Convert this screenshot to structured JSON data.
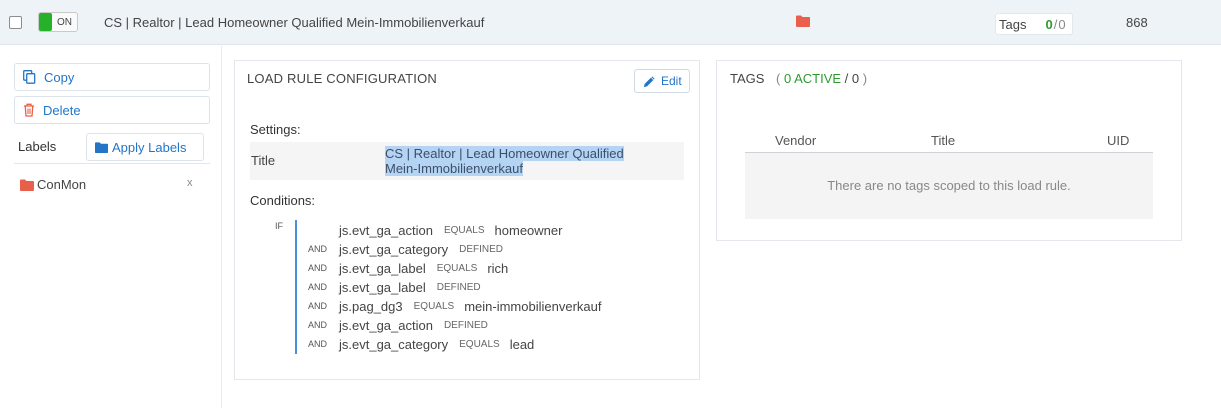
{
  "row": {
    "toggle_label": "ON",
    "rule_name": "CS | Realtor | Lead Homeowner Qualified Mein-Immobilienverkauf",
    "tags_label": "Tags",
    "tags_active": "0",
    "tags_sep": "/",
    "tags_total": "0",
    "rule_id": "868"
  },
  "sidebar": {
    "copy_label": "Copy",
    "delete_label": "Delete",
    "labels_heading": "Labels",
    "apply_labels_label": "Apply Labels",
    "label_items": [
      {
        "name": "ConMon",
        "remove": "x"
      }
    ]
  },
  "config": {
    "heading": "LOAD RULE CONFIGURATION",
    "edit_label": "Edit",
    "settings_heading": "Settings:",
    "title_label": "Title",
    "title_value": "CS | Realtor | Lead Homeowner Qualified Mein-Immobilienverkauf",
    "conditions_heading": "Conditions:",
    "if_label": "IF",
    "conditions": [
      {
        "join": "",
        "variable": "js.evt_ga_action",
        "operator": "EQUALS",
        "value": "homeowner"
      },
      {
        "join": "AND",
        "variable": "js.evt_ga_category",
        "operator": "DEFINED",
        "value": ""
      },
      {
        "join": "AND",
        "variable": "js.evt_ga_label",
        "operator": "EQUALS",
        "value": "rich"
      },
      {
        "join": "AND",
        "variable": "js.evt_ga_label",
        "operator": "DEFINED",
        "value": ""
      },
      {
        "join": "AND",
        "variable": "js.pag_dg3",
        "operator": "EQUALS",
        "value": "mein-immobilienverkauf"
      },
      {
        "join": "AND",
        "variable": "js.evt_ga_action",
        "operator": "DEFINED",
        "value": ""
      },
      {
        "join": "AND",
        "variable": "js.evt_ga_category",
        "operator": "EQUALS",
        "value": "lead"
      }
    ]
  },
  "tags_panel": {
    "heading": "TAGS",
    "count_open": "(",
    "count_active": "0 ACTIVE",
    "count_sep": "/",
    "count_total": "0",
    "count_close": ")",
    "columns": [
      "Vendor",
      "Title",
      "UID"
    ],
    "empty_message": "There are no tags scoped to this load rule."
  },
  "colors": {
    "accent": "#2375c8",
    "on_green": "#25b12a",
    "active_green": "#2e9a2e",
    "folder_orange": "#e8604c",
    "row_bg": "#eef3f8"
  },
  "icons": [
    "checkbox",
    "toggle-switch",
    "folder-icon",
    "copy-icon",
    "trash-icon",
    "pencil-icon"
  ]
}
